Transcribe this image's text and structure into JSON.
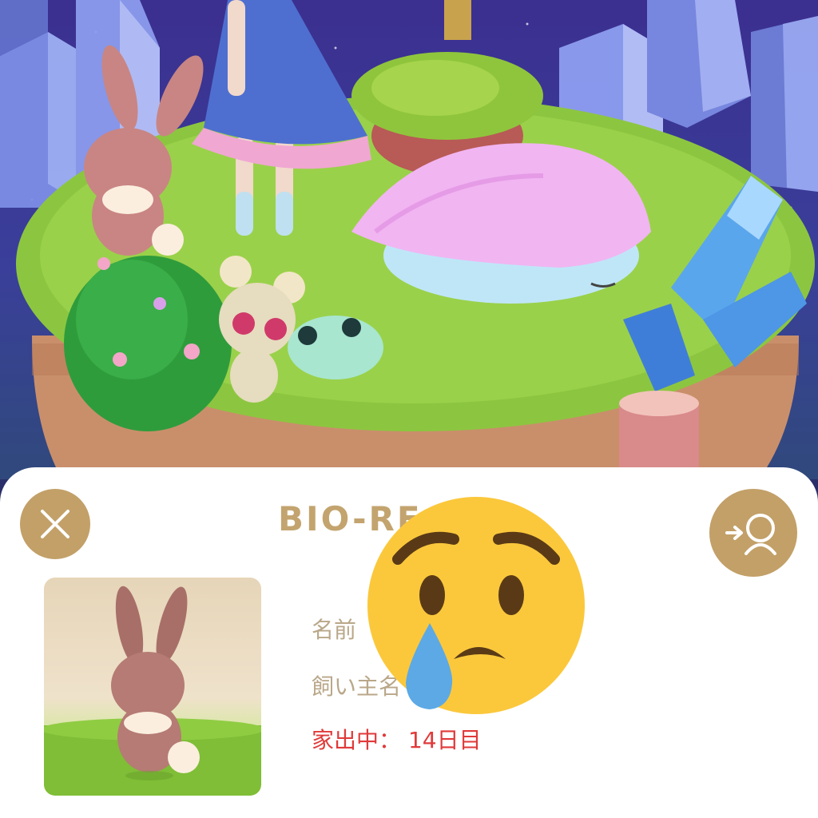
{
  "dialog": {
    "title": "BIO-RE",
    "name_label": "名前",
    "owner_label": "飼い主名",
    "status": {
      "label": "家出中",
      "separator": "：",
      "value": "14日目"
    }
  },
  "buttons": {
    "close_icon": "close-x-icon",
    "share_icon": "share-to-friend-icon"
  },
  "overlay": {
    "emoji": "sad-but-relieved-face (disappointed face with tear)"
  },
  "colors": {
    "accent_gold": "#c2a068",
    "title_gold": "#c3a46f",
    "label_beige": "#b9a789",
    "status_red": "#e03a3a",
    "sheet_bg": "#ffffff"
  }
}
